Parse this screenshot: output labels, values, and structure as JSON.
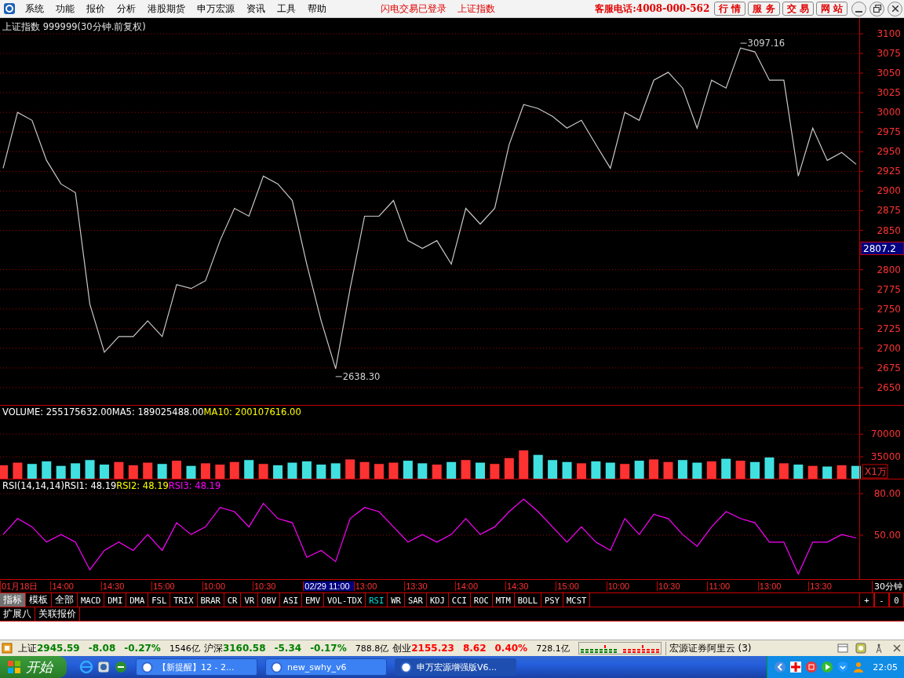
{
  "menu": {
    "items": [
      "系统",
      "功能",
      "报价",
      "分析",
      "港股期货",
      "申万宏源",
      "资讯",
      "工具",
      "帮助"
    ],
    "notices": [
      "闪电交易已登录",
      "上证指数"
    ],
    "hotline": "客服电话:4008-000-562",
    "buttons": [
      "行 情",
      "服 务",
      "交 易",
      "网 站"
    ]
  },
  "price_panel": {
    "title": "上证指数 999999(30分钟.前复权)",
    "current_price": "2807.2",
    "high_label": "3097.16",
    "low_label": "2638.30",
    "chart_data": {
      "type": "line",
      "series": [
        {
          "color": "#c8c8c8",
          "values": [
            2929,
            3000,
            2990,
            2939,
            2909,
            2898,
            2756,
            2695,
            2715,
            2715,
            2735,
            2715,
            2781,
            2776,
            2786,
            2837,
            2878,
            2868,
            2919,
            2909,
            2888,
            2807,
            2735,
            2674,
            2776,
            2868,
            2868,
            2888,
            2837,
            2827,
            2837,
            2807,
            2878,
            2858,
            2878,
            2959,
            3010,
            3005,
            2995,
            2980,
            2990,
            2959,
            2929,
            3000,
            2990,
            3041,
            3051,
            3031,
            2980,
            3041,
            3031,
            3082,
            3077,
            3041,
            3041,
            2919,
            2980,
            2939,
            2949,
            2934
          ]
        }
      ],
      "ylim": [
        2627,
        3120
      ],
      "grid": true,
      "yticks": [
        2650,
        2675,
        2700,
        2725,
        2750,
        2775,
        2800,
        2850,
        2875,
        2900,
        2925,
        2950,
        2975,
        3000,
        3025,
        3050,
        3075,
        3100
      ]
    }
  },
  "volume_panel": {
    "header": [
      {
        "text": "VOLUME: 255175632.00",
        "color": "#ffffff"
      },
      {
        "text": "MA5: 189025488.00",
        "color": "#ffffff"
      },
      {
        "text": "MA10: 200107616.00",
        "color": "#ffff00"
      }
    ],
    "unit": "X1万",
    "chart_data": {
      "type": "bar",
      "grid": true,
      "series": [
        {
          "color": "#ff3232",
          "values": [
            22000,
            26000,
            null,
            null,
            null,
            null,
            null,
            null,
            27000,
            22000,
            26000,
            null,
            29000,
            null,
            25000,
            23000,
            27000,
            null,
            24000,
            null,
            null,
            null,
            null,
            null,
            31000,
            27000,
            24000,
            26000,
            null,
            null,
            23000,
            null,
            30000,
            null,
            24000,
            33000,
            45000,
            null,
            null,
            null,
            25000,
            null,
            null,
            24000,
            null,
            31000,
            27000,
            null,
            null,
            28000,
            null,
            29000,
            null,
            null,
            25000,
            null,
            21000,
            null,
            22000,
            null
          ]
        },
        {
          "color": "#40e0e0",
          "values": [
            null,
            null,
            24000,
            28000,
            21000,
            25000,
            30000,
            23000,
            null,
            null,
            null,
            24000,
            null,
            21000,
            null,
            null,
            null,
            30000,
            null,
            22000,
            26000,
            28000,
            23000,
            25000,
            null,
            null,
            null,
            null,
            29000,
            25000,
            null,
            27000,
            null,
            26000,
            null,
            null,
            null,
            38000,
            30000,
            27000,
            null,
            28000,
            26000,
            null,
            29000,
            null,
            null,
            30000,
            26000,
            null,
            32000,
            null,
            27000,
            34000,
            null,
            23000,
            null,
            20000,
            null,
            21000
          ]
        }
      ],
      "ylim": [
        0,
        114000
      ],
      "yticks": [
        35000,
        70000
      ]
    }
  },
  "rsi_panel": {
    "header": [
      {
        "text": "RSI(14,14,14)",
        "color": "#ffffff"
      },
      {
        "text": "RSI1: 48.19",
        "color": "#ffffff"
      },
      {
        "text": "RSI2: 48.19",
        "color": "#ffff00"
      },
      {
        "text": "RSI3: 48.19",
        "color": "#ff00ff"
      }
    ],
    "chart_data": {
      "type": "line",
      "grid": true,
      "series": [
        {
          "color": "#ff00ff",
          "values": [
            50.5,
            62,
            56,
            45,
            50.5,
            45,
            25,
            39,
            45,
            39,
            50.5,
            39,
            59,
            50.5,
            56,
            70,
            67,
            56,
            73,
            62,
            59,
            34,
            39,
            31,
            62,
            70,
            67,
            56,
            45,
            50.5,
            45,
            50.5,
            62,
            50.5,
            56,
            67,
            76,
            67,
            56,
            45,
            56,
            45,
            39,
            62,
            50.5,
            65,
            62,
            50.5,
            42,
            56,
            67,
            62,
            59,
            45,
            45,
            22,
            45,
            45,
            50.5,
            48
          ]
        }
      ],
      "ylim": [
        18.3,
        90.2
      ],
      "yticks": [
        {
          "value": 50,
          "label": "50.00"
        },
        {
          "value": 80,
          "label": "80.00"
        }
      ]
    }
  },
  "time_axis": {
    "labels": [
      {
        "text": "01月18日",
        "selected": false
      },
      {
        "text": "14:00",
        "selected": false
      },
      {
        "text": "14:30",
        "selected": false
      },
      {
        "text": "15:00",
        "selected": false
      },
      {
        "text": "10:00",
        "selected": false
      },
      {
        "text": "10:30",
        "selected": false
      },
      {
        "text": "02/29 11:00",
        "selected": true
      },
      {
        "text": "13:00",
        "selected": false
      },
      {
        "text": "13:30",
        "selected": false
      },
      {
        "text": "14:00",
        "selected": false
      },
      {
        "text": "14:30",
        "selected": false
      },
      {
        "text": "15:00",
        "selected": false
      },
      {
        "text": "10:00",
        "selected": false
      },
      {
        "text": "10:30",
        "selected": false
      },
      {
        "text": "11:00",
        "selected": false
      },
      {
        "text": "13:00",
        "selected": false
      },
      {
        "text": "13:30",
        "selected": false
      }
    ],
    "period": "30分钟"
  },
  "indicator_tabs": [
    {
      "label": "指标",
      "selected": true
    },
    {
      "label": "模板",
      "selected": false
    },
    {
      "label": "全部",
      "selected": false
    },
    {
      "label": "MACD",
      "selected": false
    },
    {
      "label": "DMI",
      "selected": false
    },
    {
      "label": "DMA",
      "selected": false
    },
    {
      "label": "FSL",
      "selected": false
    },
    {
      "label": "TRIX",
      "selected": false
    },
    {
      "label": "BRAR",
      "selected": false
    },
    {
      "label": "CR",
      "selected": false
    },
    {
      "label": "VR",
      "selected": false
    },
    {
      "label": "OBV",
      "selected": false
    },
    {
      "label": "ASI",
      "selected": false
    },
    {
      "label": "EMV",
      "selected": false
    },
    {
      "label": "VOL-TDX",
      "selected": false
    },
    {
      "label": "RSI",
      "selected": true
    },
    {
      "label": "WR",
      "selected": false
    },
    {
      "label": "SAR",
      "selected": false
    },
    {
      "label": "KDJ",
      "selected": false
    },
    {
      "label": "CCI",
      "selected": false
    },
    {
      "label": "ROC",
      "selected": false
    },
    {
      "label": "MTM",
      "selected": false
    },
    {
      "label": "BOLL",
      "selected": false
    },
    {
      "label": "PSY",
      "selected": false
    },
    {
      "label": "MCST",
      "selected": false
    }
  ],
  "zoom_buttons": [
    "+",
    "-",
    "0"
  ],
  "extra_tabs": [
    "扩展八",
    "关联报价"
  ],
  "status_bar": {
    "indices": [
      {
        "name": "上证",
        "value": "2945.59",
        "change": "-8.08",
        "percent": "-0.27%",
        "amount": "1546亿",
        "kind": "down"
      },
      {
        "name": "沪深",
        "value": "3160.58",
        "change": "-5.34",
        "percent": "-0.17%",
        "amount": "788.8亿",
        "kind": "down"
      },
      {
        "name": "创业",
        "value": "2155.23",
        "change": "8.62",
        "percent": "0.40%",
        "amount": "728.1亿",
        "kind": "up"
      }
    ],
    "server": "宏源证券阿里云 (3)"
  },
  "taskbar": {
    "start": "开始",
    "tasks": [
      {
        "label": "【新提醒】12 - 2...",
        "selected": false
      },
      {
        "label": "new_swhy_v6",
        "selected": false
      },
      {
        "label": "申万宏源增强版V6...",
        "selected": true
      }
    ],
    "clock": "22:05"
  }
}
